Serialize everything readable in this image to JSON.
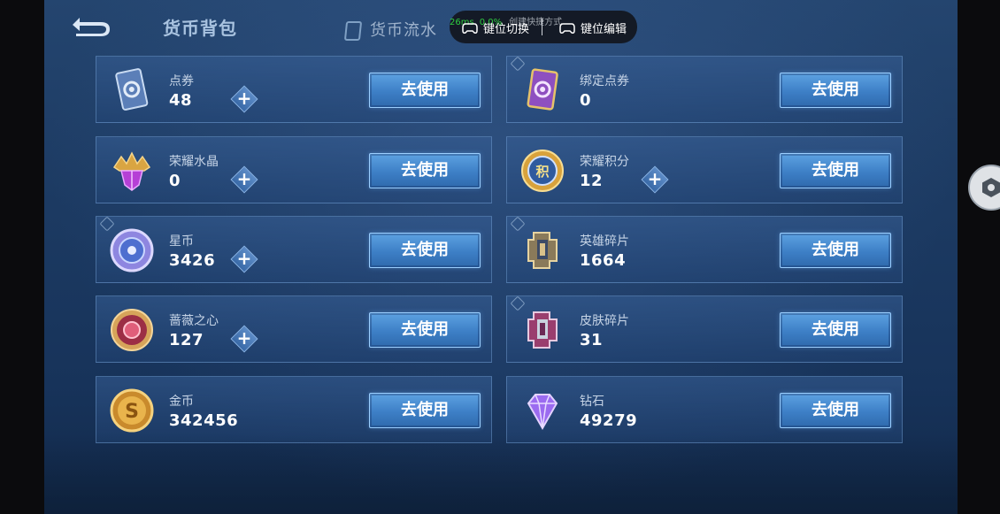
{
  "header": {
    "active_tab": "货币背包",
    "other_tab": "货币流水"
  },
  "overlay": {
    "stat_ping": "26ms",
    "stat_loss": "0.0%",
    "stat_shortcut": "创建快捷方式",
    "switch_label": "键位切换",
    "edit_label": "键位编辑"
  },
  "currencies": {
    "left": [
      {
        "name": "点券",
        "value": "48",
        "has_plus": true
      },
      {
        "name": "荣耀水晶",
        "value": "0",
        "has_plus": true
      },
      {
        "name": "星币",
        "value": "3426",
        "has_plus": true
      },
      {
        "name": "蔷薇之心",
        "value": "127",
        "has_plus": true
      },
      {
        "name": "金币",
        "value": "342456",
        "has_plus": false
      }
    ],
    "right": [
      {
        "name": "绑定点券",
        "value": "0",
        "has_plus": false
      },
      {
        "name": "荣耀积分",
        "value": "12",
        "has_plus": true
      },
      {
        "name": "英雄碎片",
        "value": "1664",
        "has_plus": false
      },
      {
        "name": "皮肤碎片",
        "value": "31",
        "has_plus": false
      },
      {
        "name": "钻石",
        "value": "49279",
        "has_plus": false
      }
    ]
  },
  "buttons": {
    "use_label": "去使用",
    "plus_label": "+"
  },
  "colors": {
    "accent_blue": "#3d7fc6",
    "background": "#1c3a62",
    "overlay_green": "#2ecc40"
  },
  "icons": {
    "back": "back-arrow-icon",
    "ticket": "ticket-card-icon",
    "bound_ticket": "purple-ticket-card-icon",
    "crystal": "glory-crystal-icon",
    "glory_points": "glory-points-medal-icon",
    "star_coin": "star-coin-icon",
    "hero_shard": "hero-shard-icon",
    "rose_heart": "rose-heart-icon",
    "skin_shard": "skin-shard-icon",
    "gold": "gold-coin-icon",
    "diamond": "diamond-icon",
    "gamepad": "gamepad-icon",
    "side": "hexagon-icon"
  }
}
